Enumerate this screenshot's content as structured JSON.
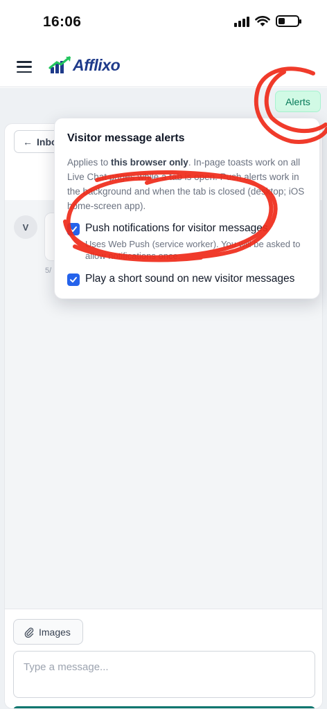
{
  "status_bar": {
    "time": "16:06",
    "icons": [
      "signal-icon",
      "wifi-icon",
      "battery-icon"
    ]
  },
  "header": {
    "logo_text": "Afflixo",
    "menu_icon": "hamburger-menu-icon"
  },
  "alerts_button": {
    "label": "Alerts"
  },
  "chat": {
    "inbox_button_label": "Inbo",
    "avatar_initial": "V",
    "message_time": "5/"
  },
  "popover": {
    "title": "Visitor message alerts",
    "description_prefix": "Applies to ",
    "description_bold": "this browser only",
    "description_rest": ". In-page toasts work on all Live Chat pages while a tab is open. Push alerts work in the background and when the tab is closed (desktop; iOS home-screen app).",
    "push_option": {
      "label": "Push notifications for visitor messages",
      "sub": "Uses Web Push (service worker). You will be asked to allow notifications once.",
      "checked": true
    },
    "sound_option": {
      "label": "Play a short sound on new visitor messages",
      "checked": true
    }
  },
  "composer": {
    "images_button_label": "Images",
    "message_placeholder": "Type a message..."
  },
  "colors": {
    "accent_green": "#047857",
    "checkbox_blue": "#2563eb",
    "annotation_red": "#ef2b1a",
    "send_teal": "#0f766e"
  }
}
